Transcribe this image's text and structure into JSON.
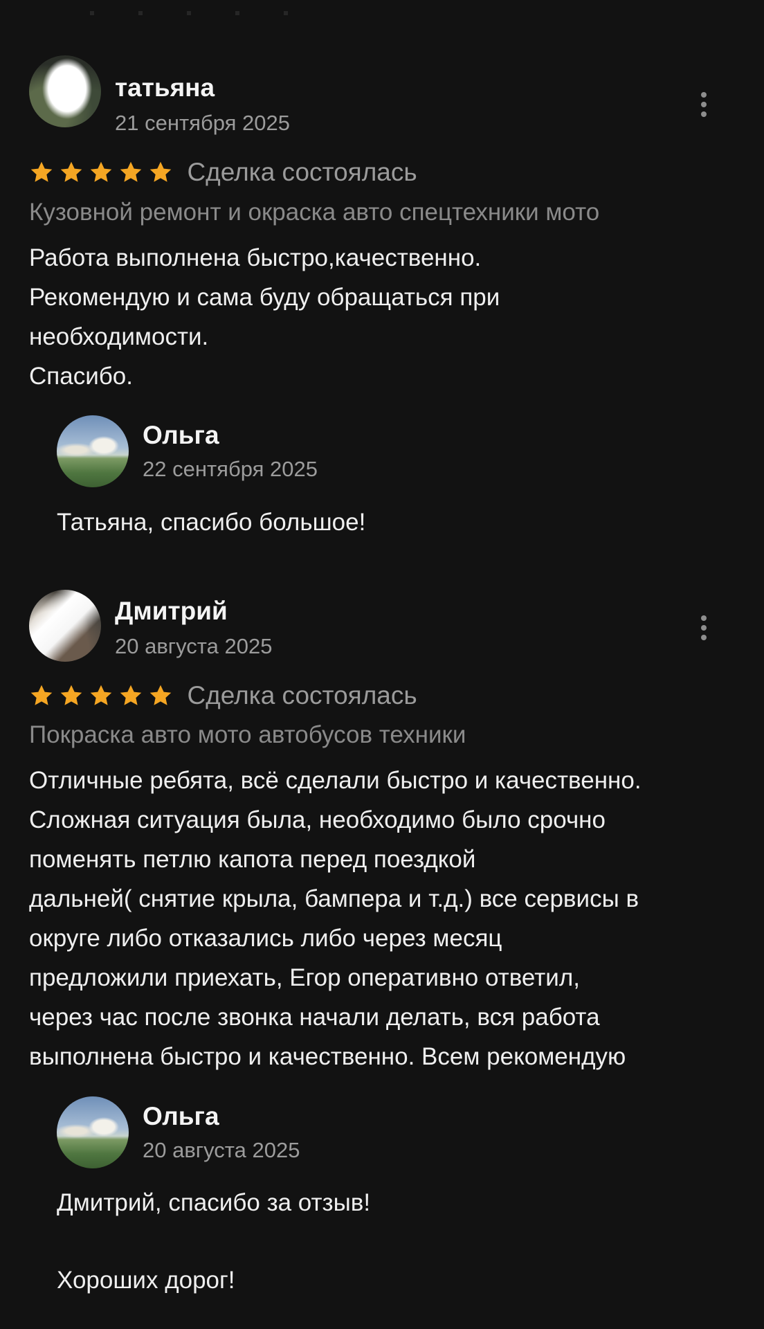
{
  "reviews": [
    {
      "author": "татьяна",
      "date": "21 сентября 2025",
      "rating": 5,
      "status": "Сделка состоялась",
      "service": "Кузовной ремонт и окраска авто спецтехники мото",
      "text_lines": [
        "Работа выполнена быстро,качественно.",
        "Рекомендую и сама буду обращаться при",
        "необходимости.",
        "Спасибо."
      ],
      "reply": {
        "author": "Ольга",
        "date": "22 сентября 2025",
        "text_lines": [
          "Татьяна, спасибо большое!"
        ]
      }
    },
    {
      "author": "Дмитрий",
      "date": "20 августа 2025",
      "rating": 5,
      "status": "Сделка состоялась",
      "service": "Покраска авто мото автобусов техники",
      "text_lines": [
        "Отличные ребята, всё сделали быстро и качественно.",
        "Сложная ситуация была, необходимо было срочно",
        "поменять петлю капота перед поездкой",
        "дальней( снятие крыла, бампера и т.д.) все сервисы в",
        "округе либо отказались либо через месяц",
        "предложили приехать, Егор оперативно ответил,",
        "через час после звонка начали делать, вся работа",
        "выполнена быстро и качественно. Всем рекомендую"
      ],
      "reply": {
        "author": "Ольга",
        "date": "20 августа 2025",
        "text_lines": [
          "Дмитрий, спасибо за отзыв!",
          "Хороших дорог!"
        ]
      }
    }
  ],
  "icons": {
    "star": "star-icon",
    "menu": "more-vertical-icon"
  },
  "colors": {
    "background": "#121212",
    "star": "#f5a623",
    "secondary_text": "#9b9b9b"
  }
}
